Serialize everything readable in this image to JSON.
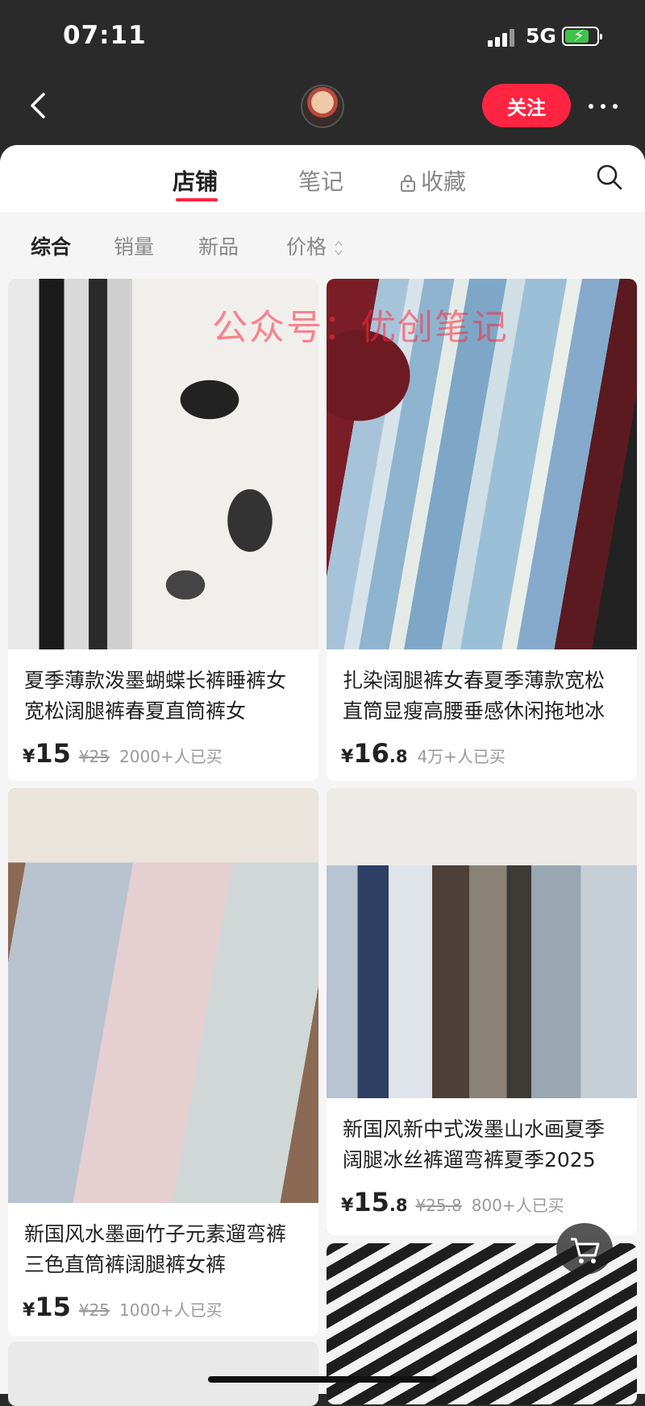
{
  "status": {
    "time": "07:11",
    "network": "5G"
  },
  "header": {
    "follow_label": "关注"
  },
  "tabs": [
    {
      "label": "店铺",
      "active": true
    },
    {
      "label": "笔记",
      "active": false
    },
    {
      "label": "收藏",
      "active": false
    }
  ],
  "filters": [
    {
      "label": "综合",
      "active": true
    },
    {
      "label": "销量",
      "active": false
    },
    {
      "label": "新品",
      "active": false
    },
    {
      "label": "价格",
      "active": false
    }
  ],
  "watermark": "公众号：优创笔记",
  "products": [
    {
      "title": "夏季薄款泼墨蝴蝶长裤睡裤女宽松阔腿裤春夏直筒裤女",
      "price_currency": "¥",
      "price_int": "15",
      "price_dec": "",
      "old_price": "¥25",
      "sold": "2000+人已买"
    },
    {
      "title": "扎染阔腿裤女春夏季薄款宽松直筒显瘦高腰垂感休闲拖地冰",
      "price_currency": "¥",
      "price_int": "16",
      "price_dec": ".8",
      "old_price": "",
      "sold": "4万+人已买"
    },
    {
      "title": "新国风水墨画竹子元素遛弯裤三色直筒裤阔腿裤女裤",
      "price_currency": "¥",
      "price_int": "15",
      "price_dec": "",
      "old_price": "¥25",
      "sold": "1000+人已买"
    },
    {
      "title": "新国风新中式泼墨山水画夏季阔腿冰丝裤遛弯裤夏季2025",
      "price_currency": "¥",
      "price_int": "15",
      "price_dec": ".8",
      "old_price": "¥25.8",
      "sold": "800+人已买"
    }
  ],
  "colors": {
    "accent": "#ff2442",
    "battery": "#3ec34a"
  }
}
